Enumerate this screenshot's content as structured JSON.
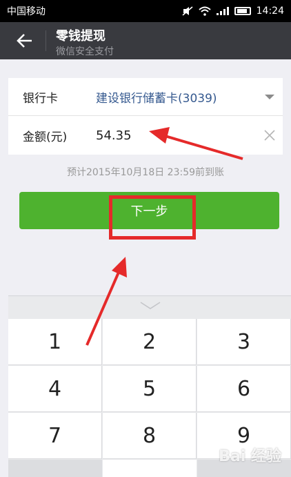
{
  "status_bar": {
    "carrier": "中国移动",
    "time": "14:24"
  },
  "header": {
    "title": "零钱提现",
    "subtitle": "微信安全支付",
    "icons": [
      "back-arrow-icon"
    ]
  },
  "form": {
    "bank_label": "银行卡",
    "bank_value": "建设银行储蓄卡(3039)",
    "amount_label": "金额(元)",
    "amount_value": "54.35"
  },
  "eta_text": "预计2015年10月18日 23:59前到账",
  "next_button_label": "下一步",
  "keypad": {
    "keys": [
      "1",
      "2",
      "3",
      "4",
      "5",
      "6",
      "7",
      "8",
      "9"
    ]
  },
  "watermark": "Bai 经验",
  "colors": {
    "title_bar": "#393a3f",
    "button_green": "#4eb22f",
    "bank_blue": "#35598f",
    "annotation_red": "#e52a2a",
    "background": "#efeff4"
  }
}
